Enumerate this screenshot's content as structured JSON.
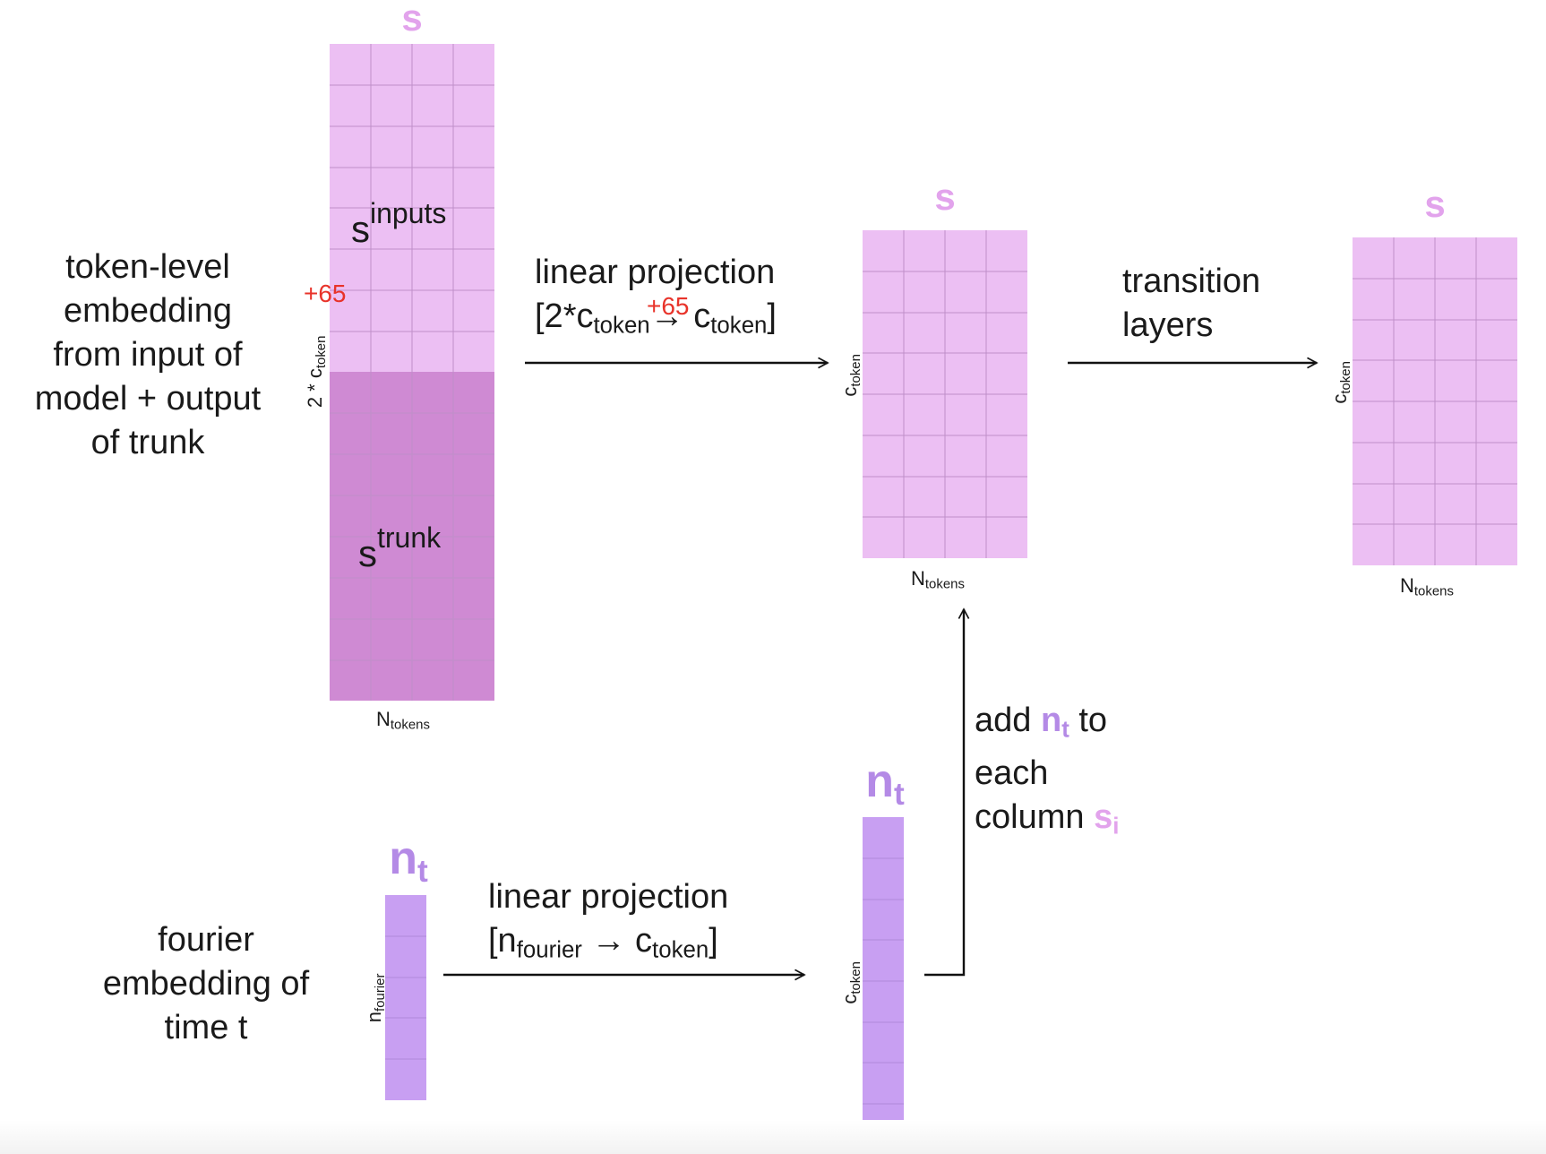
{
  "colors": {
    "s_light": "#ecbff3",
    "s_dark": "#cf8ad3",
    "n_block": "#c89ff2",
    "grid": "#bf8fc8",
    "symbol_s": "#e2a3ec",
    "symbol_n": "#b48ae6",
    "annotation": "#e8332a"
  },
  "labels": {
    "token_embedding": [
      "token-level",
      "embedding",
      "from input of",
      "model + output",
      "of trunk"
    ],
    "fourier_embedding": [
      "fourier",
      "embedding of",
      "time t"
    ],
    "linear_proj_1_line1": "linear projection",
    "linear_proj_1_line2_a": "[2*c",
    "linear_proj_1_line2_b": "token",
    "linear_proj_1_line2_c": "→ c",
    "linear_proj_1_line2_d": "token",
    "linear_proj_1_line2_e": "]",
    "linear_proj_2_line1": "linear projection",
    "linear_proj_2_line2_a": "[n",
    "linear_proj_2_line2_b": "fourier",
    "linear_proj_2_line2_c": " → c",
    "linear_proj_2_line2_d": "token",
    "linear_proj_2_line2_e": "]",
    "transition_line1": "transition",
    "transition_line2": "layers",
    "add_line1_a": "add ",
    "add_line1_n": "n",
    "add_line1_t": "t",
    "add_line1_b": " to",
    "add_line2": "each",
    "add_line3_a": "column ",
    "add_line3_s": "s",
    "add_line3_i": "i"
  },
  "symbols": {
    "s": "s",
    "n": "n",
    "t": "t"
  },
  "blocks": {
    "s_inputs_base": "s",
    "s_inputs_sup": "inputs",
    "s_trunk_base": "s",
    "s_trunk_sup": "trunk"
  },
  "dims": {
    "N": "N",
    "tokens": "tokens",
    "c": "c",
    "token": "token",
    "two_c": "2 * c",
    "n": "n",
    "fourier": "fourier"
  },
  "annotations": {
    "plus65_a": "+65",
    "plus65_b": "+65"
  }
}
